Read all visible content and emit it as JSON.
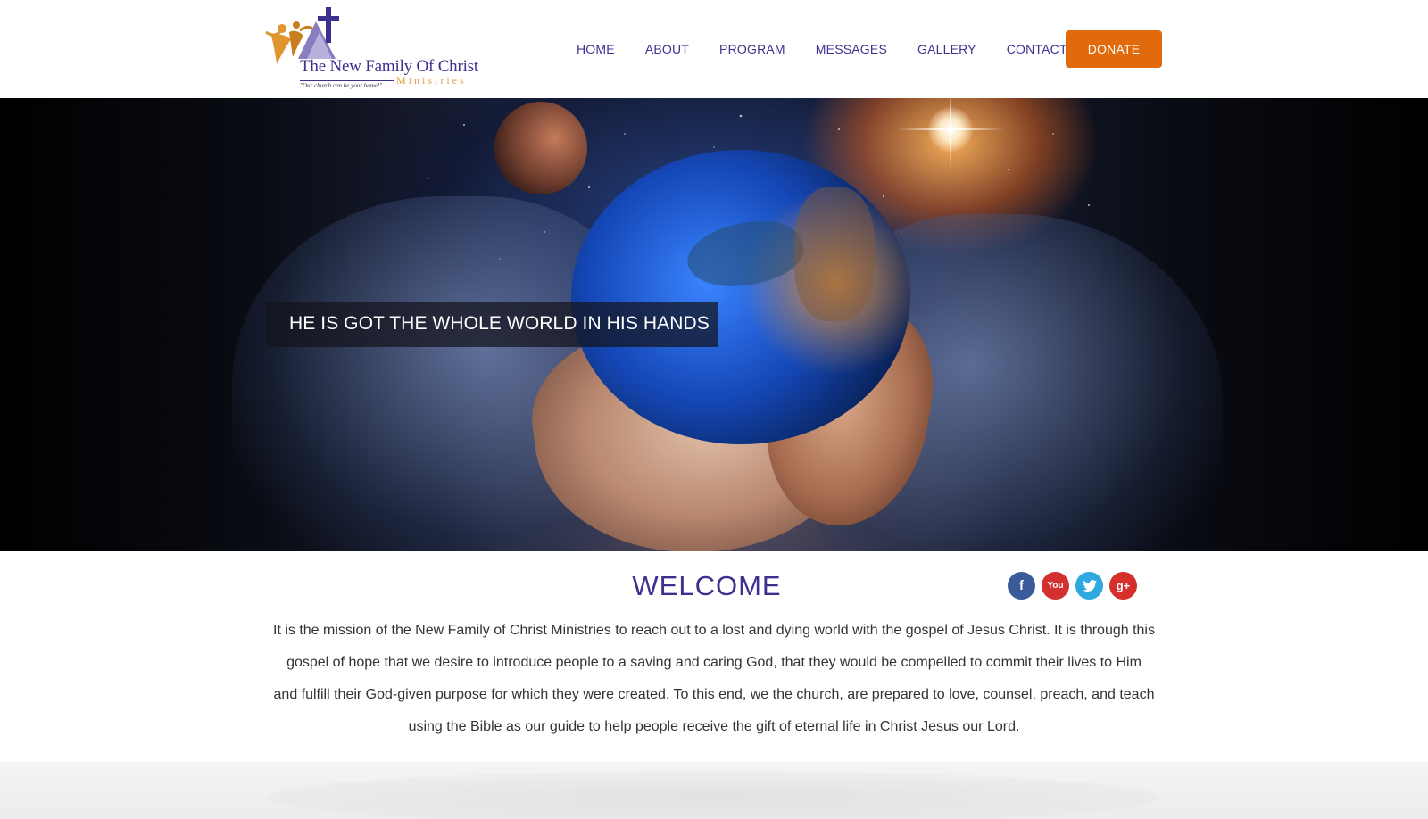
{
  "logo": {
    "title": "The New Family Of Christ",
    "subtitle": "Ministries",
    "tagline": "\"Our church can be your home!\""
  },
  "nav": {
    "items": [
      "HOME",
      "ABOUT",
      "PROGRAM",
      "MESSAGES",
      "GALLERY",
      "CONTACT"
    ],
    "donate_label": "DONATE"
  },
  "hero": {
    "caption": "HE IS GOT THE WHOLE WORLD IN HIS HANDS"
  },
  "welcome": {
    "title": "WELCOME",
    "text": "It is the mission of the New Family of Christ Ministries to reach out to a lost and dying world with the gospel of Jesus Christ. It is through this gospel of hope that we desire to introduce people to a saving and caring God, that they would be compelled to commit their lives to Him and fulfill their God-given purpose for which they were created. To this end, we the church, are prepared to love, counsel, preach, and teach using the Bible as our guide to help people receive the gift of eternal life in Christ Jesus our Lord."
  },
  "social": {
    "icons": [
      "facebook-icon",
      "youtube-icon",
      "twitter-icon",
      "google-plus-icon"
    ]
  },
  "colors": {
    "brand_purple": "#3d3190",
    "donate_orange": "#e06a0c",
    "logo_gold": "#e0a04a"
  }
}
